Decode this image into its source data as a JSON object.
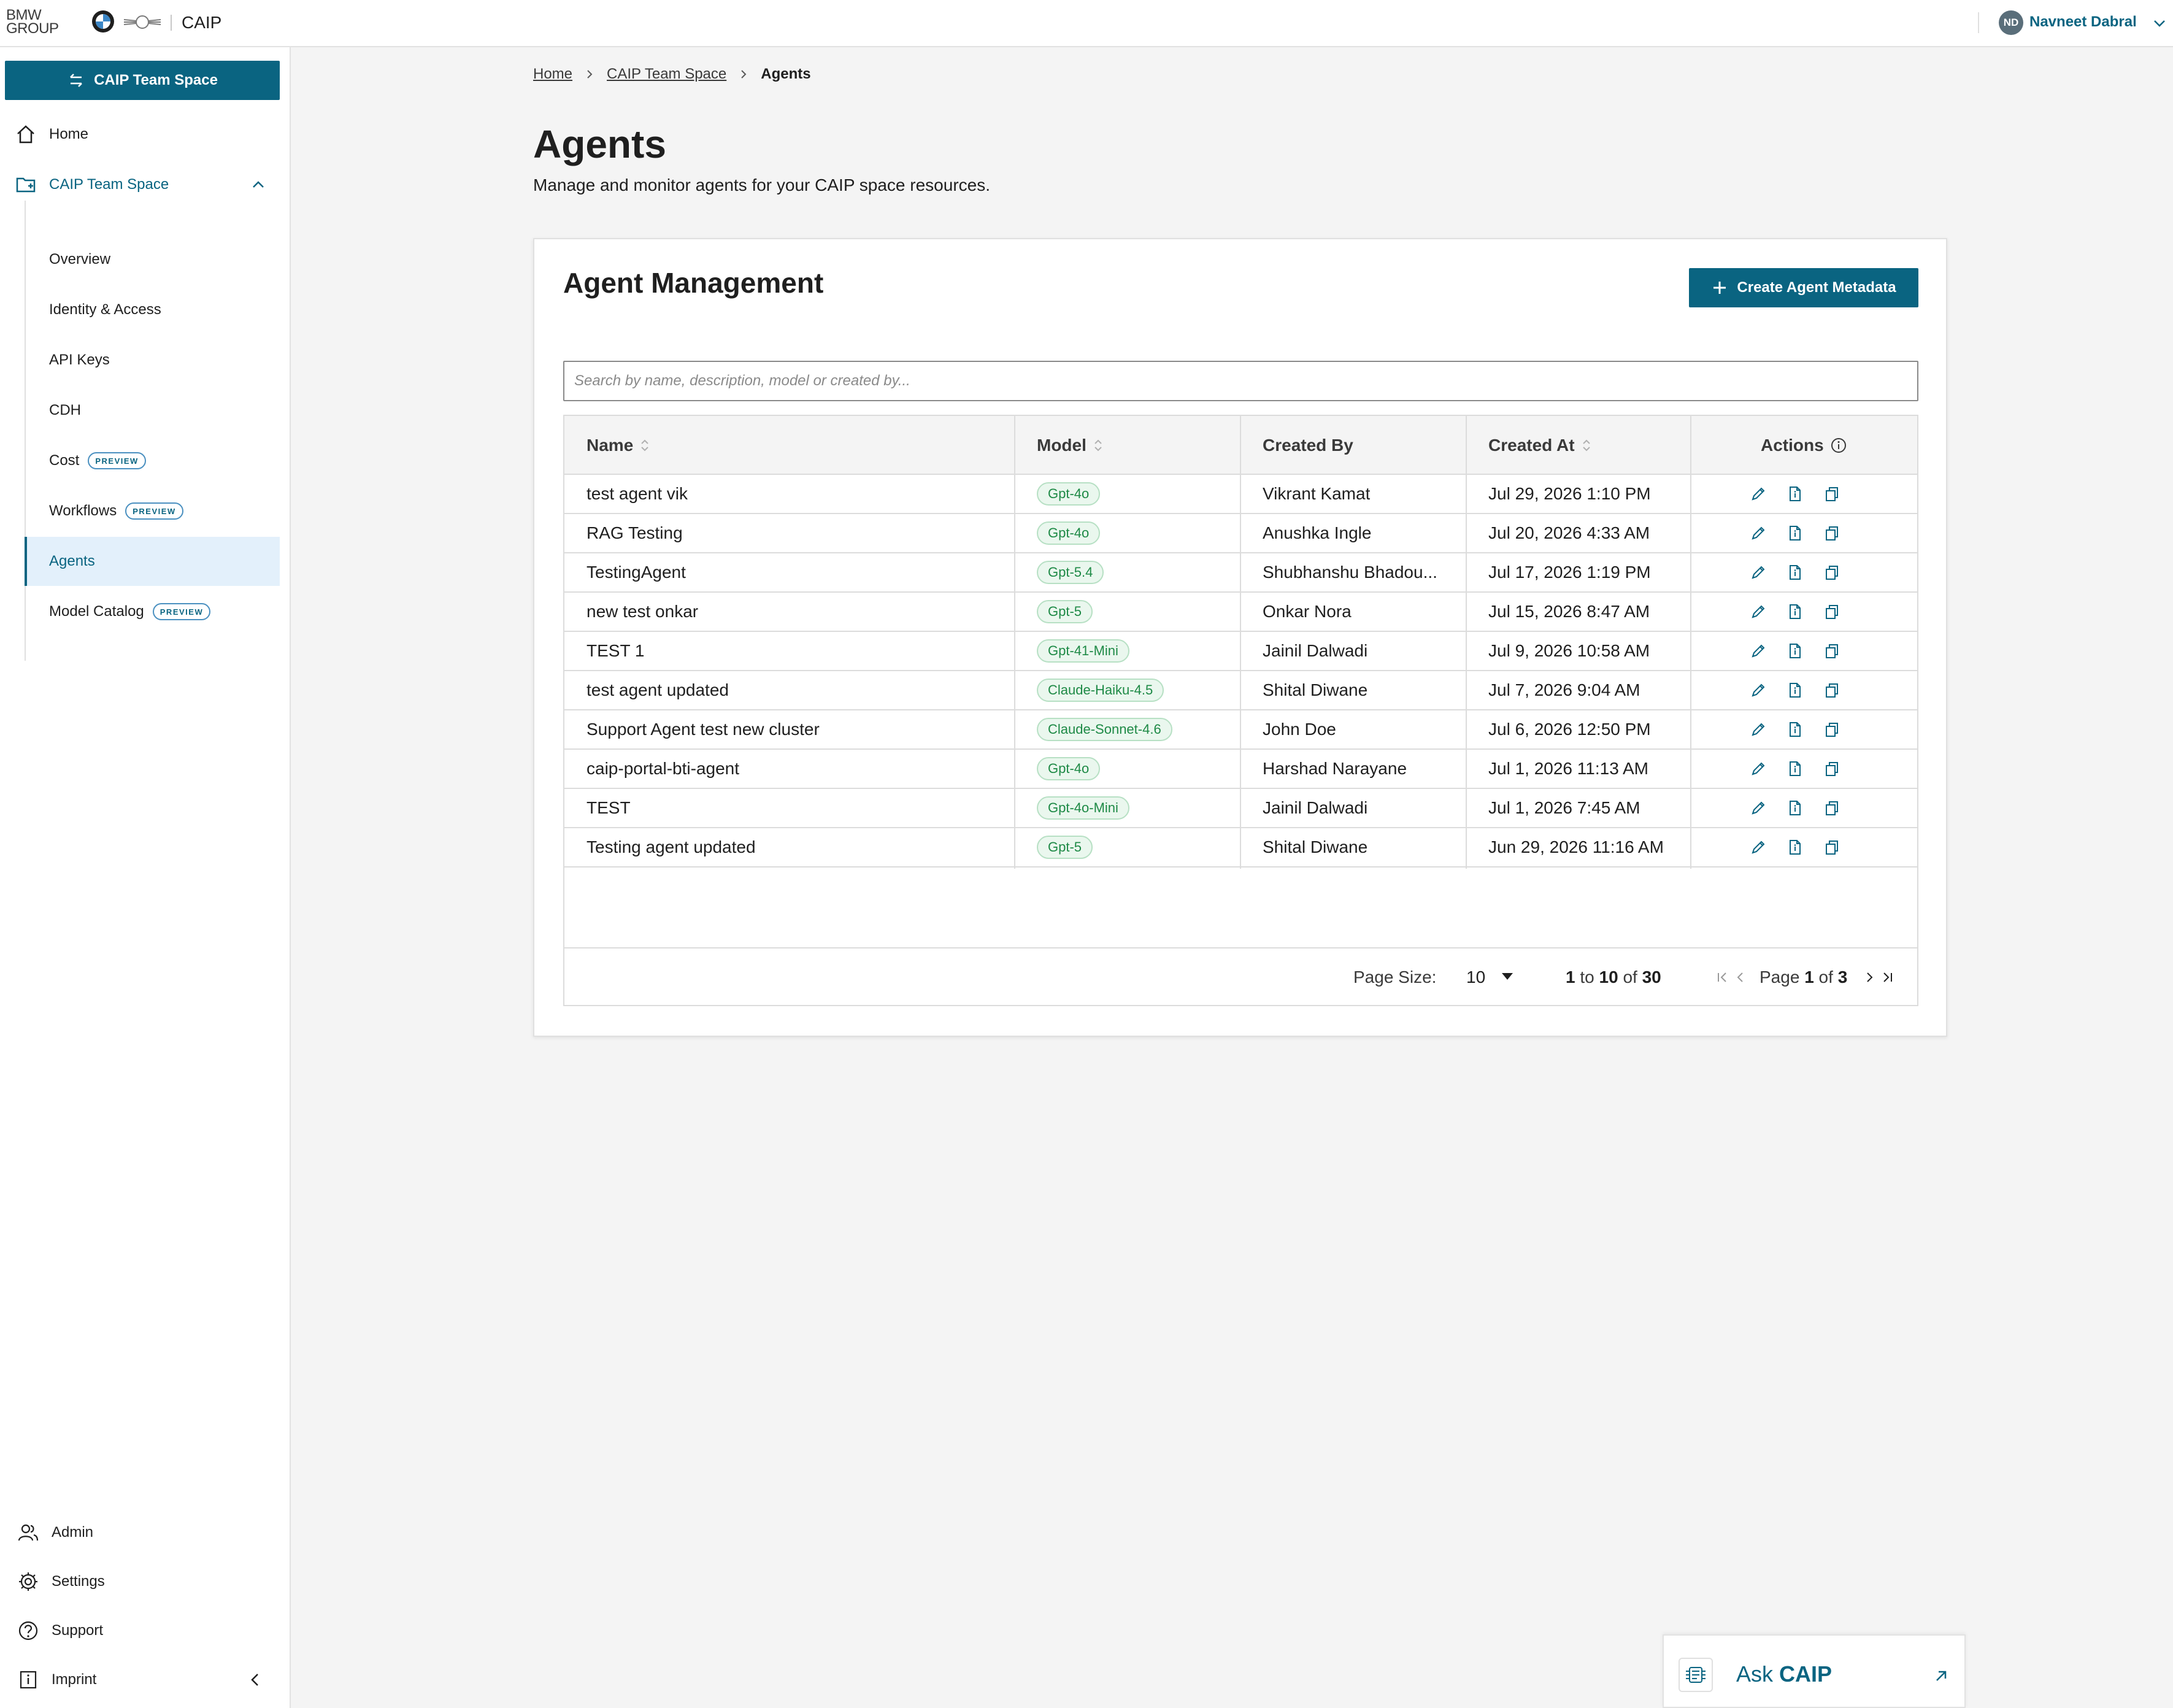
{
  "header": {
    "brand_text_line1": "BMW",
    "brand_text_line2": "GROUP",
    "app_name": "CAIP",
    "user_initials": "ND",
    "user_name": "Navneet Dabral"
  },
  "sidebar": {
    "space_button_label": "CAIP Team Space",
    "home_label": "Home",
    "team_space_label": "CAIP Team Space",
    "sub_items": [
      {
        "label": "Overview",
        "badge": ""
      },
      {
        "label": "Identity & Access",
        "badge": ""
      },
      {
        "label": "API Keys",
        "badge": ""
      },
      {
        "label": "CDH",
        "badge": ""
      },
      {
        "label": "Cost",
        "badge": "PREVIEW"
      },
      {
        "label": "Workflows",
        "badge": "PREVIEW"
      },
      {
        "label": "Agents",
        "badge": ""
      },
      {
        "label": "Model Catalog",
        "badge": "PREVIEW"
      }
    ],
    "bottom_items": [
      {
        "label": "Admin"
      },
      {
        "label": "Settings"
      },
      {
        "label": "Support"
      },
      {
        "label": "Imprint"
      }
    ]
  },
  "breadcrumb": {
    "home": "Home",
    "space": "CAIP Team Space",
    "current": "Agents"
  },
  "page": {
    "title": "Agents",
    "description": "Manage and monitor agents for your CAIP space resources."
  },
  "card": {
    "title": "Agent Management",
    "create_button_label": "Create Agent Metadata",
    "search_placeholder": "Search by name, description, model or created by..."
  },
  "table": {
    "columns": [
      "Name",
      "Model",
      "Created By",
      "Created At",
      "Actions"
    ],
    "rows": [
      {
        "name": "test agent vik",
        "model": "Gpt-4o",
        "created_by": "Vikrant Kamat",
        "created_at": "Jul 29, 2026 1:10 PM"
      },
      {
        "name": "RAG Testing",
        "model": "Gpt-4o",
        "created_by": "Anushka Ingle",
        "created_at": "Jul 20, 2026 4:33 AM"
      },
      {
        "name": "TestingAgent",
        "model": "Gpt-5.4",
        "created_by": "Shubhanshu Bhadou...",
        "created_at": "Jul 17, 2026 1:19 PM"
      },
      {
        "name": "new test onkar",
        "model": "Gpt-5",
        "created_by": "Onkar Nora",
        "created_at": "Jul 15, 2026 8:47 AM"
      },
      {
        "name": "TEST 1",
        "model": "Gpt-41-Mini",
        "created_by": "Jainil Dalwadi",
        "created_at": "Jul 9, 2026 10:58 AM"
      },
      {
        "name": "test agent updated",
        "model": "Claude-Haiku-4.5",
        "created_by": "Shital Diwane",
        "created_at": "Jul 7, 2026 9:04 AM"
      },
      {
        "name": "Support Agent test new cluster",
        "model": "Claude-Sonnet-4.6",
        "created_by": "John Doe",
        "created_at": "Jul 6, 2026 12:50 PM"
      },
      {
        "name": "caip-portal-bti-agent",
        "model": "Gpt-4o",
        "created_by": "Harshad Narayane",
        "created_at": "Jul 1, 2026 11:13 AM"
      },
      {
        "name": "TEST",
        "model": "Gpt-4o-Mini",
        "created_by": "Jainil Dalwadi",
        "created_at": "Jul 1, 2026 7:45 AM"
      },
      {
        "name": "Testing agent updated",
        "model": "Gpt-5",
        "created_by": "Shital Diwane",
        "created_at": "Jun 29, 2026 11:16 AM"
      }
    ],
    "action_icons": [
      "edit-icon",
      "details-icon",
      "copy-icon"
    ]
  },
  "pagination": {
    "page_size_label": "Page Size:",
    "page_size": "10",
    "range_from": "1",
    "range_to_word": "to",
    "range_to": "10",
    "range_of_word": "of",
    "total": "30",
    "page_word": "Page",
    "page_current": "1",
    "page_of_word": "of",
    "page_total": "3"
  },
  "ask": {
    "prefix": "Ask",
    "name": "CAIP"
  },
  "colors": {
    "accent": "#0a6481",
    "active_bg": "#e3f0fb",
    "badge_green": "#1e8a46"
  }
}
